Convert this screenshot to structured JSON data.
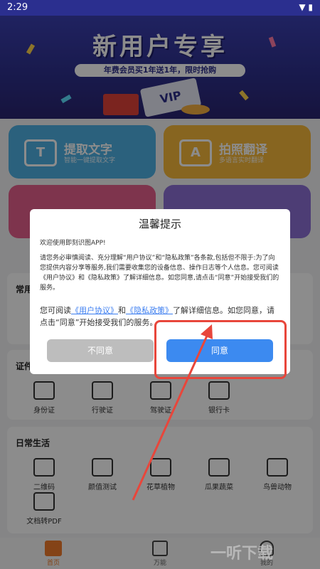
{
  "status_bar": {
    "time": "2:29"
  },
  "banner": {
    "title": "新用户专享",
    "subtitle": "年费会员买1年送1年，限时抢购",
    "badge": "VIP"
  },
  "feature_cards": [
    {
      "title": "提取文字",
      "subtitle": "智能一键提取文字",
      "icon": "text-extract-icon"
    },
    {
      "title": "拍照翻译",
      "subtitle": "多语言实时翻译",
      "icon": "photo-translate-icon"
    }
  ],
  "sections": {
    "common": {
      "title": "常用"
    },
    "documents": {
      "title": "证件",
      "items": [
        "身份证",
        "行驶证",
        "驾驶证",
        "银行卡"
      ]
    },
    "daily": {
      "title": "日常生活",
      "items": [
        "二维码",
        "颜值测试",
        "花草植物",
        "瓜果蔬菜",
        "鸟兽动物",
        "文档转PDF"
      ]
    }
  },
  "dialog": {
    "title": "温馨提示",
    "welcome": "欢迎使用即刻识图APP!",
    "body": "请您务必审慎阅读、充分理解“用户协议”和“隐私政策”各条款,包括但不限于:为了向您提供内容分享等服务,我们需要收集您的设备信息、操作日志等个人信息。您可阅读《用户协议》和《隐私政策》了解详细信息。如您同意,请点击“同意”开始接受我们的服务。",
    "body2_prefix": "您可阅读",
    "link_user_agreement": "《用户协议》",
    "body2_and": "和",
    "link_privacy_policy": "《隐私政策》",
    "body2_suffix": "了解详细信息。如您同意，请点击“同意”开始接受我们的服务。",
    "disagree_label": "不同意",
    "agree_label": "同意"
  },
  "bottom_nav": [
    {
      "label": "首页",
      "icon": "home-icon"
    },
    {
      "label": "万能",
      "icon": "scan-icon"
    },
    {
      "label": "我的",
      "icon": "profile-icon"
    }
  ],
  "watermark": "一听下载",
  "colors": {
    "accent": "#3c8af0",
    "annotation": "#e8463b"
  }
}
